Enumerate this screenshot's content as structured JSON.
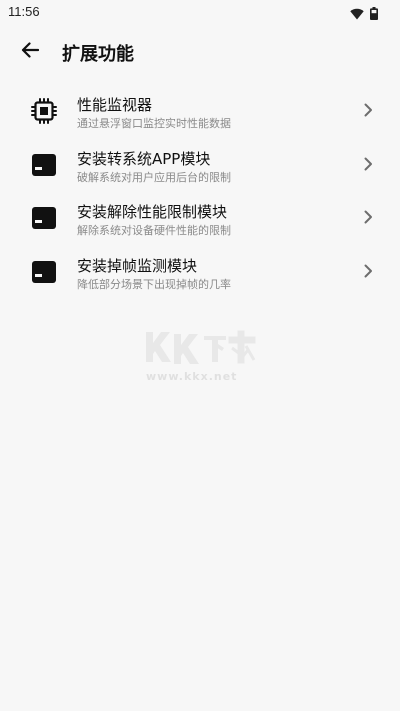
{
  "status_bar": {
    "time": "11:56",
    "icons": [
      "wifi-icon",
      "battery-icon"
    ]
  },
  "app_bar": {
    "back_icon": "back-arrow-icon",
    "title": "扩展功能"
  },
  "items": [
    {
      "icon": "chip-icon",
      "title": "性能监视器",
      "subtitle": "通过悬浮窗口监控实时性能数据"
    },
    {
      "icon": "module-icon",
      "title": "安装转系统APP模块",
      "subtitle": "破解系统对用户应用后台的限制"
    },
    {
      "icon": "module-icon",
      "title": "安装解除性能限制模块",
      "subtitle": "解除系统对设备硬件性能的限制"
    },
    {
      "icon": "module-icon",
      "title": "安装掉帧监测模块",
      "subtitle": "降低部分场景下出现掉帧的几率"
    }
  ],
  "watermark": {
    "logo_text": "KK下载",
    "url": "www.kkx.net"
  },
  "colors": {
    "background": "#f7f7f7",
    "text_primary": "#111111",
    "text_secondary": "#8a8a8a",
    "chevron": "#6d6d6d",
    "watermark": "#cfcfcf"
  }
}
